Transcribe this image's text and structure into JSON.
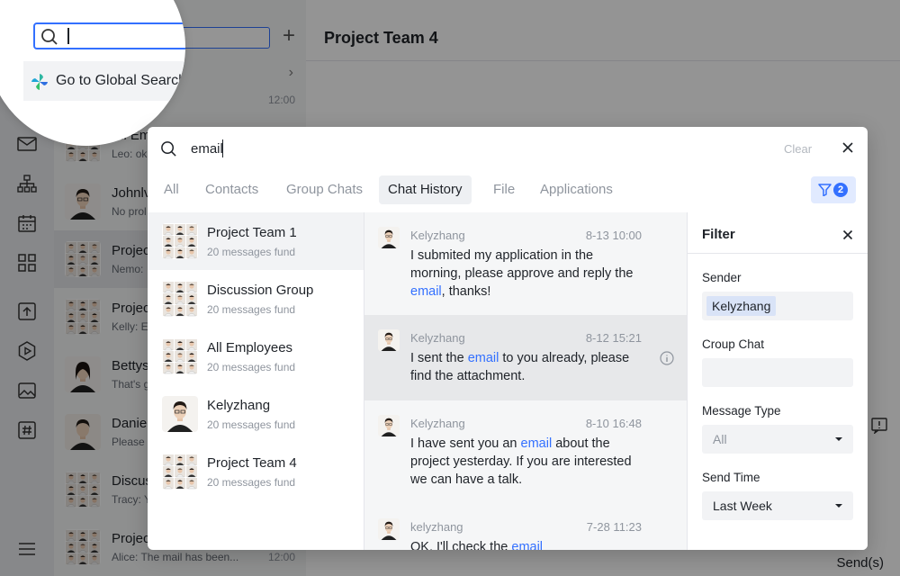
{
  "app": {
    "conversation_list": {
      "first_time": "12:00",
      "items": [
        {
          "name": "All Em",
          "preview": "Leo: ok",
          "time": "",
          "avatar": "group"
        },
        {
          "name": "Johnlv",
          "preview": "No prol",
          "time": "",
          "avatar": "person-m"
        },
        {
          "name": "Projec",
          "preview": "Nemo: ",
          "time": "",
          "avatar": "group"
        },
        {
          "name": "Projec",
          "preview": "Kelly: E",
          "time": "",
          "avatar": "group"
        },
        {
          "name": "Bettys",
          "preview": "That's g",
          "time": "",
          "avatar": "person-f"
        },
        {
          "name": "Daniel",
          "preview": "Please",
          "time": "",
          "avatar": "person-m2"
        },
        {
          "name": "Discus",
          "preview": "Tracy: Y",
          "time": "",
          "avatar": "group"
        },
        {
          "name": "Projec",
          "preview": "Alice: The mail has been...",
          "time": "12:00",
          "avatar": "group"
        }
      ]
    },
    "main": {
      "title": "Project Team 4",
      "send_label": "Send(s)"
    }
  },
  "magnifier": {
    "global_search_label": "Go to Global Search"
  },
  "search": {
    "query": "email",
    "clear_label": "Clear",
    "tabs": [
      {
        "label": "All",
        "active": false
      },
      {
        "label": "Contacts",
        "active": false
      },
      {
        "label": "Group Chats",
        "active": false
      },
      {
        "label": "Chat History",
        "active": true
      },
      {
        "label": "File",
        "active": false
      },
      {
        "label": "Applications",
        "active": false
      }
    ],
    "filter_badge": "2",
    "results": [
      {
        "name": "Project Team 1",
        "count": "20 messages fund",
        "avatar": "group"
      },
      {
        "name": "Discussion Group",
        "count": "20 messages fund",
        "avatar": "group"
      },
      {
        "name": "All Employees",
        "count": "20 messages fund",
        "avatar": "group"
      },
      {
        "name": "Kelyzhang",
        "count": "20 messages fund",
        "avatar": "person-m"
      },
      {
        "name": "Project Team 4",
        "count": "20 messages fund",
        "avatar": "group"
      }
    ],
    "messages": [
      {
        "sender": "Kelyzhang",
        "time": "8-13 10:00",
        "before": "I submited my application in the morning, please approve and reply the ",
        "keyword": "email",
        "after": ", thanks!"
      },
      {
        "sender": "Kelyzhang",
        "time": "8-12 15:21",
        "before": "I sent the ",
        "keyword": "email",
        "after": " to you already, please find the attachment."
      },
      {
        "sender": "Kelyzhang",
        "time": "8-10 16:48",
        "before": "I have sent you an ",
        "keyword": "email",
        "after": " about the project yesterday. If you are interested we can have a talk."
      },
      {
        "sender": "kelyzhang",
        "time": "7-28 11:23",
        "before": "OK, I'll check the ",
        "keyword": "email",
        "after": ""
      }
    ],
    "filter": {
      "title": "Filter",
      "sender_label": "Sender",
      "sender_value": "Kelyzhang",
      "group_label": "Croup Chat",
      "group_value": "",
      "type_label": "Message Type",
      "type_value": "All",
      "time_label": "Send Time",
      "time_value": "Last Week"
    }
  },
  "colors": {
    "accent": "#3370ff",
    "keyword": "#3370ff",
    "badge_bg": "#e1eaff",
    "overlay": "rgba(0,0,0,0.42)"
  }
}
